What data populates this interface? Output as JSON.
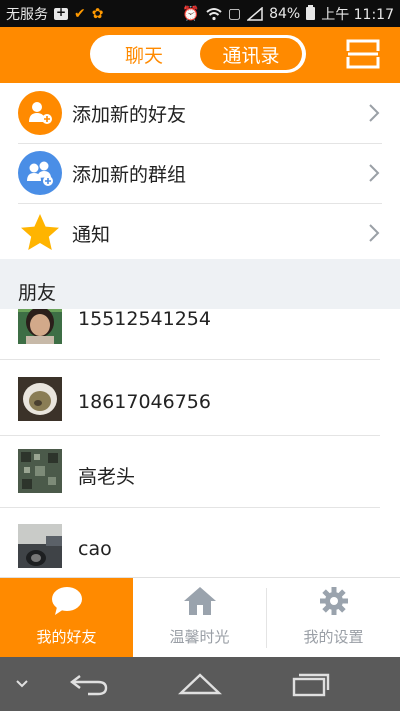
{
  "status_bar": {
    "carrier": "无服务",
    "battery": "84%",
    "time": "上午 11:17"
  },
  "header": {
    "tabs": [
      {
        "label": "聊天",
        "active": false
      },
      {
        "label": "通讯录",
        "active": true
      }
    ],
    "menu_icon": "scan-frame-icon"
  },
  "actions": [
    {
      "label": "添加新的好友",
      "icon": "add-friend-icon",
      "color": "#ff8a00"
    },
    {
      "label": "添加新的群组",
      "icon": "add-group-icon",
      "color": "#4a8ee6"
    },
    {
      "label": "通知",
      "icon": "star-icon",
      "color": "#ffb400"
    }
  ],
  "section": {
    "title": "朋友"
  },
  "friends": [
    {
      "name": "15512541254"
    },
    {
      "name": "18617046756"
    },
    {
      "name": "高老头"
    },
    {
      "name": "cao"
    }
  ],
  "tabbar": {
    "tabs": [
      {
        "label": "我的好友",
        "icon": "chat-bubble-icon",
        "active": true
      },
      {
        "label": "温馨时光",
        "icon": "home-icon",
        "active": false
      },
      {
        "label": "我的设置",
        "icon": "gear-icon",
        "active": false
      }
    ]
  },
  "colors": {
    "accent": "#ff8a00",
    "section_bg": "#eef1f4",
    "nav_bar": "#5a5a5a"
  }
}
